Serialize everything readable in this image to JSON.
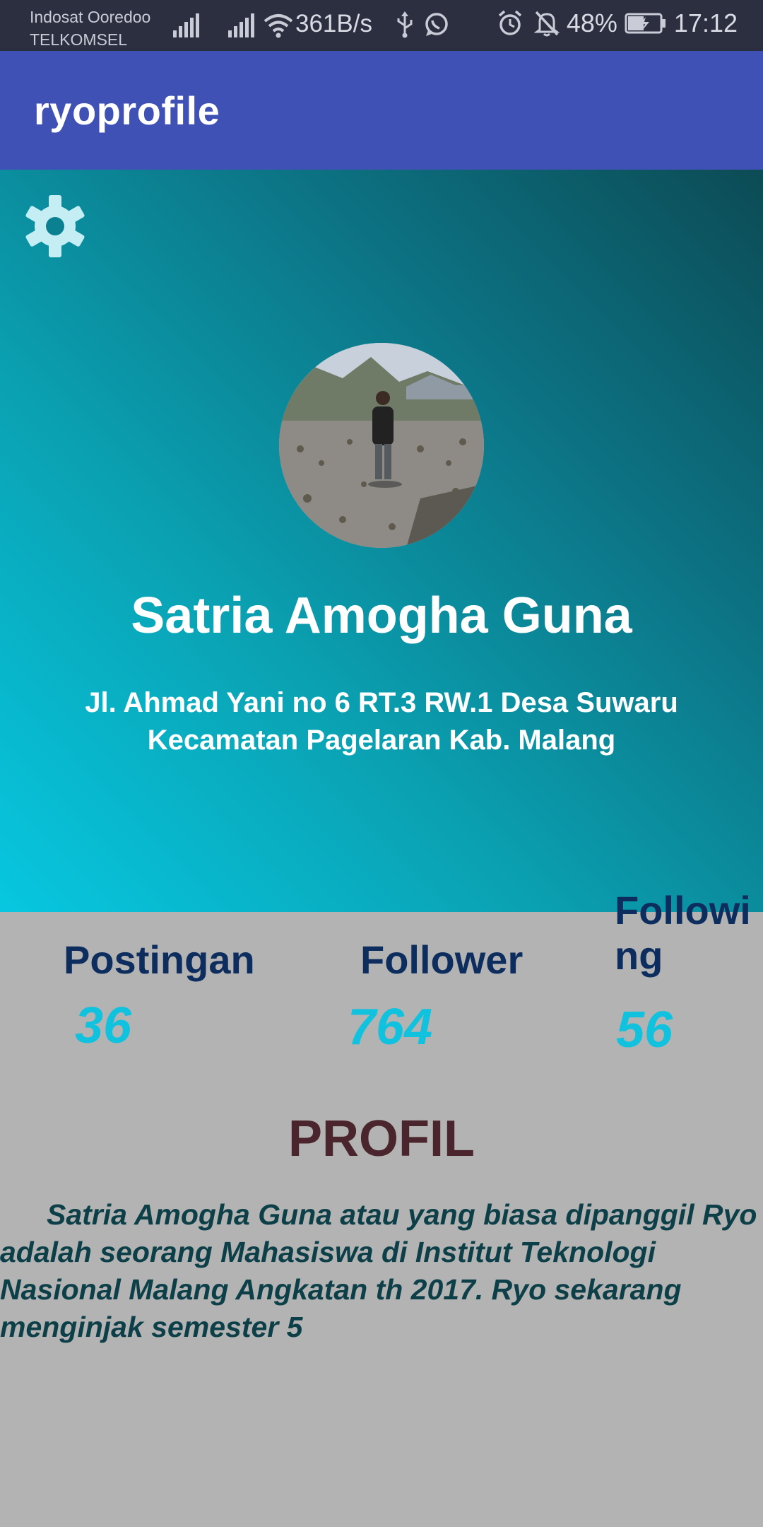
{
  "status_bar": {
    "carrier_1": "Indosat Ooredoo",
    "carrier_2": "TELKOMSEL",
    "net_speed": "361B/s",
    "battery": "48%",
    "time": "17:12",
    "icons": [
      "signal-icon",
      "signal-icon",
      "wifi-icon",
      "usb-icon",
      "whatsapp-icon",
      "alarm-icon",
      "mute-icon",
      "battery-charging-icon"
    ]
  },
  "app_bar": {
    "title": "ryoprofile"
  },
  "header": {
    "settings_icon": "gear-icon",
    "avatar_icon": "profile-photo",
    "name": "Satria Amogha Guna",
    "address_line1": "Jl. Ahmad Yani no 6 RT.3 RW.1 Desa Suwaru",
    "address_line2": "Kecamatan Pagelaran Kab. Malang"
  },
  "stats": {
    "posts_label": "Postingan",
    "posts_value": "36",
    "followers_label": "Follower",
    "followers_value": "764",
    "following_label_line1": "Followi",
    "following_label_line2": "ng",
    "following_value": "56"
  },
  "profile": {
    "heading": "PROFIL",
    "bio": "Satria Amogha Guna atau yang biasa dipanggil Ryo adalah seorang Mahasiswa di Institut Teknologi Nasional Malang Angkatan th 2017. Ryo sekarang menginjak semester 5"
  },
  "colors": {
    "app_bar": "#3f51b5",
    "status_bar": "#2b2f3f",
    "stat_label": "#0d2d5e",
    "stat_value": "#11c2de",
    "profil_heading": "#4a252d",
    "bio_text": "#0c3f48",
    "background": "#b3b3b3"
  }
}
